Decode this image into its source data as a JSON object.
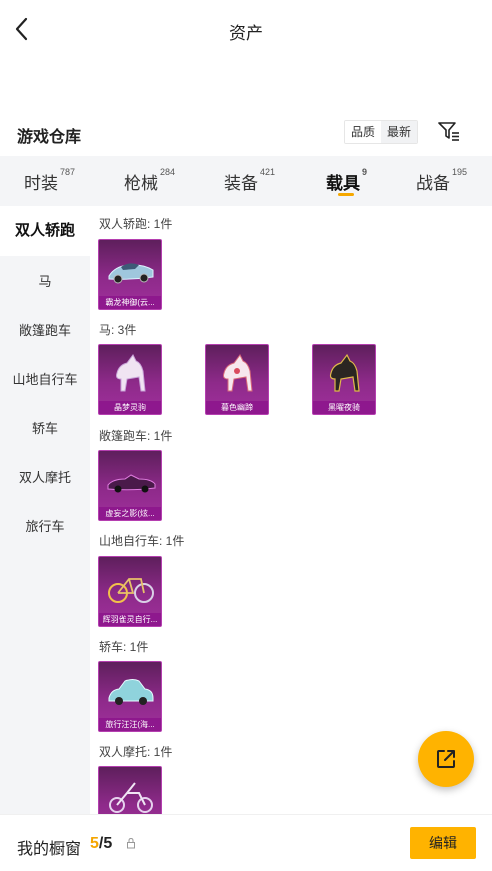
{
  "header": {
    "title": "资产"
  },
  "warehouse": {
    "title": "游戏仓库",
    "sort_options": [
      "品质",
      "最新"
    ]
  },
  "tabs": [
    {
      "label": "时装",
      "count": "787"
    },
    {
      "label": "枪械",
      "count": "284"
    },
    {
      "label": "装备",
      "count": "421"
    },
    {
      "label": "载具",
      "count": "9"
    },
    {
      "label": "战备",
      "count": "195"
    }
  ],
  "sidebar": {
    "items": [
      "双人轿跑",
      "马",
      "敞篷跑车",
      "山地自行车",
      "轿车",
      "双人摩托",
      "旅行车"
    ]
  },
  "sections": [
    {
      "title": "双人轿跑: 1件",
      "items": [
        {
          "name": "霸龙神御(云...",
          "icon": "sports-car-icon"
        }
      ]
    },
    {
      "title": "马: 3件",
      "items": [
        {
          "name": "晶梦灵驹",
          "icon": "horse-icon"
        },
        {
          "name": "暮色幽蹄",
          "icon": "horse-icon"
        },
        {
          "name": "黑曜夜骑",
          "icon": "horse-icon"
        }
      ]
    },
    {
      "title": "敞篷跑车: 1件",
      "items": [
        {
          "name": "虚妄之影(炫...",
          "icon": "convertible-car-icon"
        }
      ]
    },
    {
      "title": "山地自行车: 1件",
      "items": [
        {
          "name": "辉羽雀灵自行...",
          "icon": "bicycle-icon"
        }
      ]
    },
    {
      "title": "轿车: 1件",
      "items": [
        {
          "name": "旅行汪汪(海...",
          "icon": "sedan-icon"
        }
      ]
    },
    {
      "title": "双人摩托: 1件",
      "items": [
        {
          "name": "",
          "icon": "motorcycle-icon"
        }
      ]
    }
  ],
  "bottom": {
    "label": "我的橱窗",
    "count_current": "5",
    "count_total": "/5",
    "edit_label": "编辑"
  },
  "colors": {
    "accent": "#ffb300",
    "card_purple": "#8e2a8a"
  }
}
